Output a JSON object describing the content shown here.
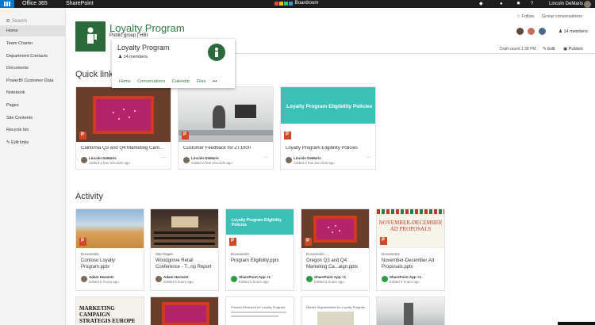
{
  "suite": {
    "app_name": "Office 365",
    "site_name": "SharePoint",
    "brand_text": "Boardroom",
    "user_name": "Lincoln DeMaris",
    "icons": [
      "waffle-icon",
      "notification-icon",
      "settings-icon",
      "help-icon"
    ]
  },
  "sidebar": {
    "search_placeholder": "Search",
    "items": [
      {
        "label": "Home",
        "active": true
      },
      {
        "label": "Team Charter"
      },
      {
        "label": "Department Contacts"
      },
      {
        "label": "Documents"
      },
      {
        "label": "PowerBI Customer Data"
      },
      {
        "label": "Notebook"
      },
      {
        "label": "Pages"
      },
      {
        "label": "Site Contents"
      },
      {
        "label": "Recycle bin"
      },
      {
        "label": "Edit links"
      }
    ]
  },
  "header": {
    "title": "Loyalty Program",
    "subtitle": "Public group  |  HBI",
    "follow": "Follow",
    "group_conversations": "Group conversations",
    "members": "14 members",
    "draft_saved": "Draft saved 1:38 PM",
    "edit": "Edit",
    "publish": "Publish"
  },
  "hovercard": {
    "title": "Loyalty Program",
    "members": "14 members",
    "links": [
      "Home",
      "Conversations",
      "Calendar",
      "Files",
      "•••"
    ]
  },
  "quick_links": {
    "heading": "Quick link",
    "cards": [
      {
        "title": "California Q3 and Q4 Marketing Cam...",
        "author": "Lincoln DeMaris",
        "added": "Added a few seconds ago",
        "thumb": "red"
      },
      {
        "title": "Customer Feedback for ZT1000",
        "author": "Lincoln DeMaris",
        "added": "Added a few seconds ago",
        "thumb": "office"
      },
      {
        "title": "Loyalty Program Eligibility Policies",
        "author": "Lincoln DeMaris",
        "added": "Added a few seconds ago",
        "thumb": "teal",
        "thumb_text": "Loyalty Program Eligibility Policies"
      }
    ]
  },
  "activity": {
    "heading": "Activity",
    "cards": [
      {
        "library": "Documents",
        "title1": "Contoso Loyalty",
        "title2": "Program.pptx",
        "author": "Adam Harmetz",
        "edited": "Edited 5 hours ago",
        "thumb": "field"
      },
      {
        "library": "Site Pages",
        "title1": "Woodgrove Retail",
        "title2": "Conference - T...rip Report",
        "author": "Adam Harmetz",
        "edited": "Edited 5 hours ago",
        "thumb": "conf"
      },
      {
        "library": "Documents",
        "title1": "Program Eligibility.pptx",
        "title2": "",
        "author": "SharePoint App +1",
        "edited": "Edited 5 hours ago",
        "thumb": "teal",
        "thumb_text": "Loyalty Program Eligibility Policies"
      },
      {
        "library": "Documents",
        "title1": "Oregon Q3 and Q4",
        "title2": "Marketing Ca...aign.pptx",
        "author": "SharePoint App +1",
        "edited": "Edited 5 hours ago",
        "thumb": "red"
      },
      {
        "library": "Documents",
        "title1": "November-December Ad",
        "title2": "Proposals.pptx",
        "author": "SharePoint App +1",
        "edited": "Edited 5 hours ago",
        "thumb": "nov",
        "thumb_text": "NOVEMBER-DECEMBER AD PROPOSALS"
      }
    ],
    "row2": [
      {
        "thumb_text": "MARKETING CAMPAIGN STRATEGIS EUROPE"
      },
      {
        "thumb_text": ""
      },
      {
        "thumb_text": "Product Research for Loyalty Program"
      },
      {
        "thumb_text": "Market Segmentation for Loyalty Program"
      },
      {
        "thumb_text": ""
      }
    ]
  },
  "colors": {
    "accent": "#2a7a45",
    "suite_bar": "#1e1e1e",
    "waffle": "#0078d4",
    "ppt": "#d24726"
  }
}
